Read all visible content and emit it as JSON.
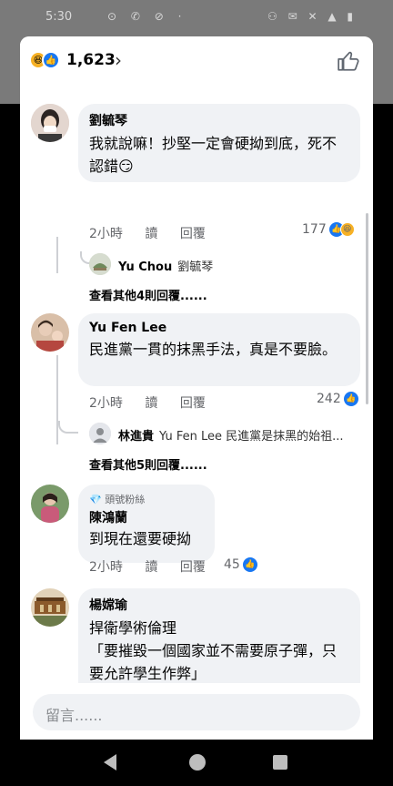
{
  "status": {
    "time": "5:30",
    "left_icons": "⊙ ✆ ⊘ ·",
    "right_icons": "⚇ ✉ ✕ ▲ ▮"
  },
  "header": {
    "reaction_count": "1,623",
    "haha_glyph": "😆",
    "like_glyph": "👍",
    "chevron": "›"
  },
  "comments": [
    {
      "name": "劉毓琴",
      "text": "我就說嘛！抄堅一定會硬拗到底，死不認錯😏",
      "time": "2小時",
      "read": "讀",
      "reply": "回覆",
      "reactions": "177",
      "reply_preview": {
        "name": "Yu Chou",
        "text": "劉毓琴"
      },
      "more": "查看其他4則回覆......"
    },
    {
      "name": "Yu Fen Lee",
      "text": "民進黨一貫的抹黑手法，真是不要臉。",
      "time": "2小時",
      "read": "讀",
      "reply": "回覆",
      "reactions": "242",
      "reply_preview": {
        "name": "林進貴",
        "text": "Yu Fen Lee 民進黨是抹黑的始祖..."
      },
      "more": "查看其他5則回覆......"
    },
    {
      "badge": "頭號粉絲",
      "name": "陳鴻蘭",
      "text": "到現在還要硬拗",
      "time": "2小時",
      "read": "讀",
      "reply": "回覆",
      "reactions": "45"
    },
    {
      "name": "楊嫦瑜",
      "text": "捍衛學術倫理\n「要摧毀一個國家並不需要原子彈，只要允許學生作弊」\n會硬拗的人不會懂得這句話的真意及價值。"
    }
  ],
  "composer": {
    "placeholder": "留言......"
  },
  "colors": {
    "accent": "#1877f2",
    "bubble": "#f0f2f5",
    "meta": "#65676b"
  }
}
